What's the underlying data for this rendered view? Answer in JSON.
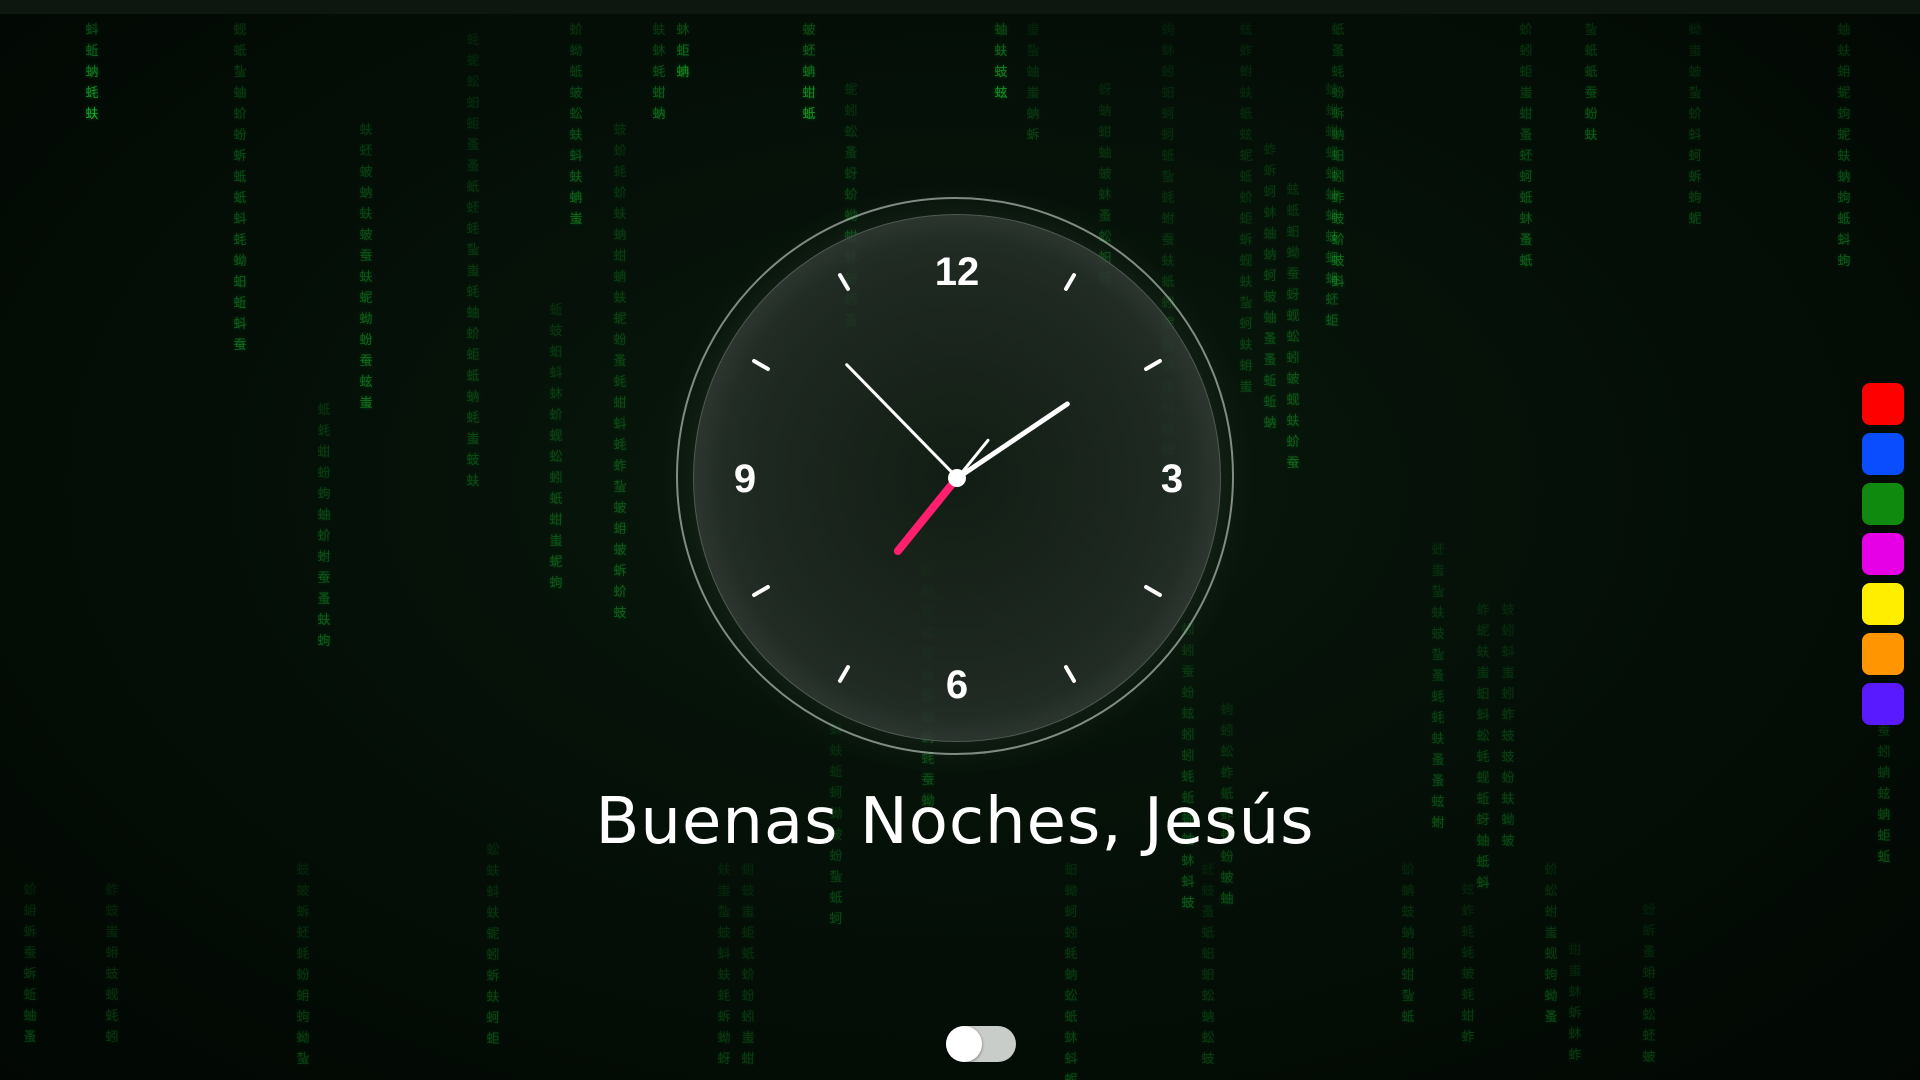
{
  "greeting": "Buenas Noches, Jesús",
  "clock": {
    "numbers": {
      "n12": "12",
      "n3": "3",
      "n6": "6",
      "n9": "9"
    },
    "time": {
      "hour": 1,
      "minute": 52,
      "second": 36.5
    }
  },
  "palette": {
    "colors": [
      "#ff0000",
      "#0a4dff",
      "#0f8a0f",
      "#e600e6",
      "#ffee00",
      "#ff9500",
      "#5a1aff"
    ]
  },
  "theme_toggle": {
    "on": false
  },
  "matrix": {
    "glyph_color": "#18c02e",
    "glyphs": "蚓蚨蚔蚑蚋蚎蚕蚜蚝蚞蚡蚣蚤蚦蚧蚨蚩蚪蚬蚭蚯蚰蚱蚳蚴蚵蚶蚷蚸蚹蚺蚻蚼蚽蚾蚿"
  }
}
